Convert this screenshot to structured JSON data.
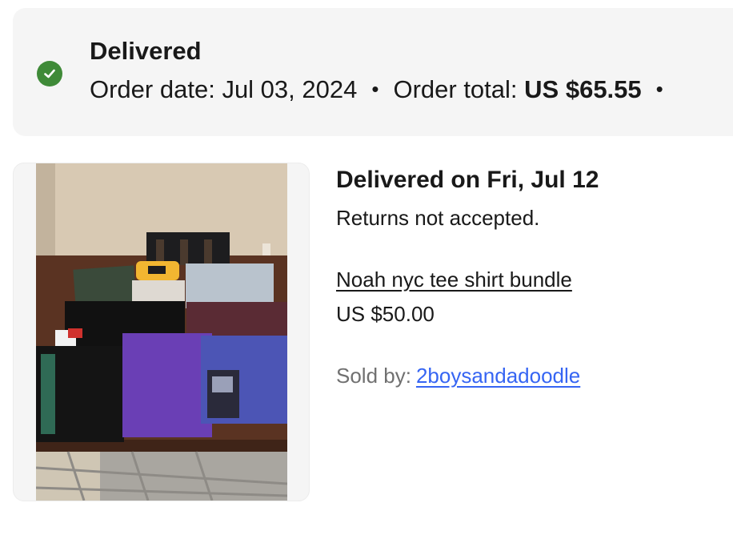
{
  "order_header": {
    "status": "Delivered",
    "order_date_label": "Order date:",
    "order_date": "Jul 03, 2024",
    "separator": "•",
    "order_total_label": "Order total:",
    "order_total": "US $65.55",
    "trailing_separator": "•"
  },
  "item": {
    "delivery_status": "Delivered on Fri, Jul 12",
    "returns_policy": "Returns not accepted.",
    "title": "Noah nyc tee shirt bundle",
    "price": "US $50.00",
    "sold_by_label": "Sold by:",
    "seller": "2boysandadoodle"
  },
  "icons": {
    "status": "check-circle-icon"
  },
  "colors": {
    "success": "#3f8a38",
    "link": "#3665f3",
    "header_bg": "#f5f5f5",
    "muted_text": "#707070"
  }
}
